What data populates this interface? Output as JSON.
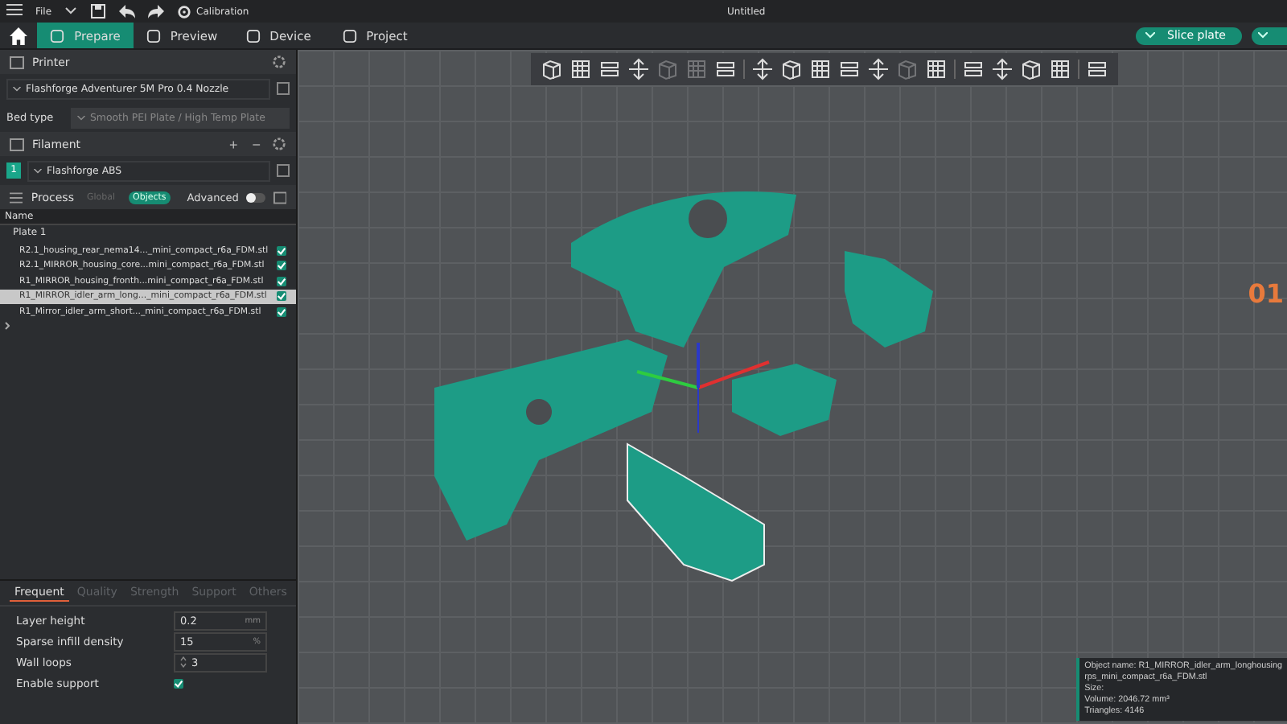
{
  "menu_bar": {
    "file": "File",
    "calibration": "Calibration",
    "title": "Untitled"
  },
  "tabs": [
    {
      "label": "Prepare",
      "selected": true
    },
    {
      "label": "Preview",
      "selected": false
    },
    {
      "label": "Device",
      "selected": false
    },
    {
      "label": "Project",
      "selected": false
    }
  ],
  "slice_button": "Slice plate",
  "printer": {
    "heading": "Printer",
    "name": "Flashforge Adventurer 5M Pro 0.4 Nozzle",
    "bed_type_label": "Bed type",
    "bed_type": "Smooth PEI Plate / High Temp Plate"
  },
  "filament": {
    "heading": "Filament",
    "plus": "+",
    "minus": "−",
    "slot": "1",
    "name": "Flashforge ABS"
  },
  "process": {
    "heading": "Process",
    "modes": [
      {
        "label": "Global",
        "selected": false
      },
      {
        "label": "Objects",
        "selected": true
      }
    ],
    "advanced_label": "Advanced",
    "advanced": false
  },
  "object_list": {
    "column": "Name",
    "plate": "Plate 1",
    "objects": [
      {
        "name": "R2.1_housing_rear_nema14..._mini_compact_r6a_FDM.stl",
        "checked": true,
        "selected": false
      },
      {
        "name": "R2.1_MIRROR_housing_core...mini_compact_r6a_FDM.stl",
        "checked": true,
        "selected": false
      },
      {
        "name": "R1_MIRROR_housing_fronth...mini_compact_r6a_FDM.stl",
        "checked": true,
        "selected": false
      },
      {
        "name": "R1_MIRROR_idler_arm_long..._mini_compact_r6a_FDM.stl",
        "checked": true,
        "selected": true
      },
      {
        "name": "R1_Mirror_idler_arm_short..._mini_compact_r6a_FDM.stl",
        "checked": true,
        "selected": false
      }
    ]
  },
  "settings_tabs": [
    {
      "label": "Frequent",
      "selected": true
    },
    {
      "label": "Quality",
      "selected": false
    },
    {
      "label": "Strength",
      "selected": false
    },
    {
      "label": "Support",
      "selected": false
    },
    {
      "label": "Others",
      "selected": false
    }
  ],
  "settings": [
    {
      "kind": "unit",
      "label": "Layer height",
      "value": "0.2",
      "unit": "mm"
    },
    {
      "kind": "unit",
      "label": "Sparse infill density",
      "value": "15",
      "unit": "%"
    },
    {
      "kind": "spin",
      "label": "Wall loops",
      "value": "3"
    },
    {
      "kind": "check",
      "label": "Enable support",
      "checked": true
    }
  ],
  "plate_number": "01",
  "object_info": [
    "Object name: R1_MIRROR_idler_arm_longhousing",
    "rps_mini_compact_r6a_FDM.stl",
    "Size:",
    "Volume: 2046.72 mm³",
    "Triangles: 4146"
  ]
}
